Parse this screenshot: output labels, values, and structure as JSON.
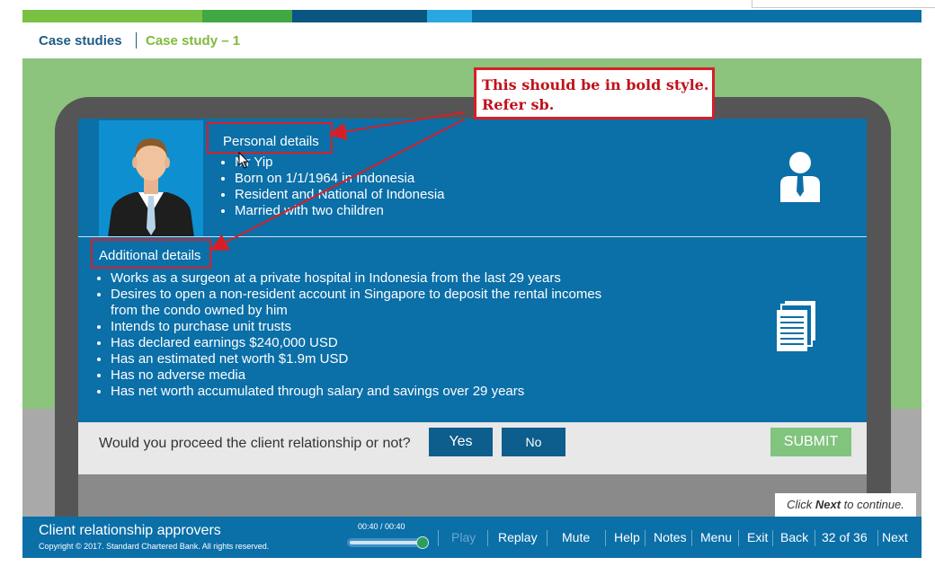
{
  "breadcrumb": {
    "root": "Case studies",
    "current": "Case study – 1"
  },
  "annotation": {
    "line1": "This should be in bold style.",
    "line2": "Refer sb."
  },
  "personal": {
    "heading": "Personal details",
    "items": [
      "Mr Yip",
      "Born on 1/1/1964 in Indonesia",
      "Resident and National of Indonesia",
      "Married with two children"
    ]
  },
  "additional": {
    "heading": "Additional details",
    "items": [
      "Works as a surgeon at a private hospital in Indonesia from the last 29 years",
      "Desires to open a non-resident account in Singapore to deposit the rental incomes from the condo owned by him",
      "Intends to purchase unit trusts",
      "Has declared earnings $240,000 USD",
      "Has an estimated net worth $1.9m USD",
      "Has no adverse media",
      "Has net worth accumulated through salary and savings over 29 years"
    ]
  },
  "question": {
    "text": "Would you proceed the client relationship or not?",
    "yes": "Yes",
    "no": "No",
    "submit": "SUBMIT"
  },
  "hint": {
    "prefix": "Click ",
    "strong": "Next",
    "suffix": " to continue."
  },
  "footer": {
    "title": "Client relationship approvers",
    "copyright": "Copyright © 2017. Standard Chartered Bank. All rights reserved.",
    "time": "00:40 / 00:40",
    "progress": 1.0,
    "play": "Play",
    "replay": "Replay",
    "mute": "Mute",
    "help": "Help",
    "notes": "Notes",
    "menu": "Menu",
    "exit": "Exit",
    "back": "Back",
    "page": "32 of 36",
    "next": "Next"
  },
  "colors": {
    "brand_blue": "#0b6fa8",
    "brand_green": "#7dbb3b",
    "annotation_red": "#d61f26"
  },
  "icons": [
    "cursor-icon",
    "user-icon",
    "documents-icon"
  ]
}
